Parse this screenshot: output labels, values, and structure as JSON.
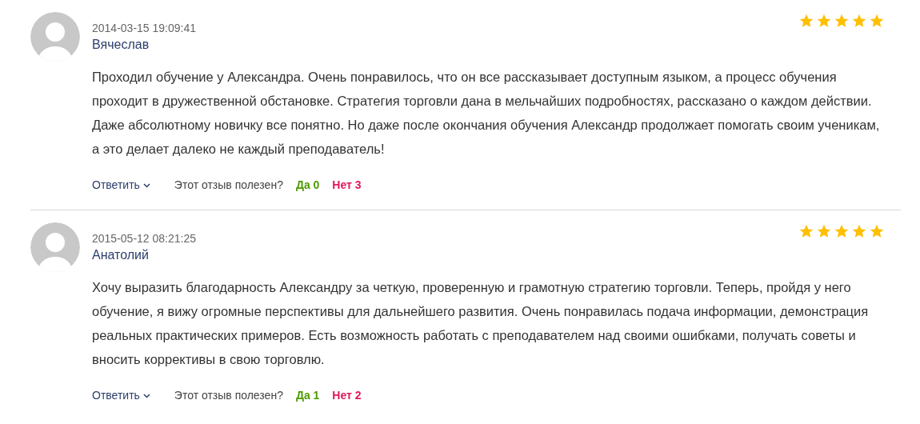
{
  "reviews": [
    {
      "date": "2014-03-15 19:09:41",
      "author": "Вячеслав",
      "stars": 5,
      "text": "Проходил обучение у Александра. Очень понравилось, что он все рассказывает доступным языком, а процесс обучения проходит в дружественной обстановке. Стратегия торговли дана в мельчайших подробностях, рассказано о каждом действии. Даже абсолютному новичку все понятно. Но даже после окончания обучения Александр продолжает помогать своим ученикам, а это делает далеко не каждый преподаватель!",
      "reply": "Ответить",
      "helpful_question": "Этот отзыв полезен?",
      "yes": "Да 0",
      "no": "Нет 3"
    },
    {
      "date": "2015-05-12 08:21:25",
      "author": "Анатолий",
      "stars": 5,
      "text": "Хочу выразить благодарность Александру за четкую, проверенную и грамотную стратегию торговли. Теперь, пройдя у него обучение, я вижу огромные перспективы для дальнейшего развития. Очень понравилась подача информации, демонстрация реальных практических примеров. Есть возможность работать с преподавателем над своими ошибками, получать советы и вносить коррективы в свою торговлю.",
      "reply": "Ответить",
      "helpful_question": "Этот отзыв полезен?",
      "yes": "Да 1",
      "no": "Нет 2"
    }
  ]
}
